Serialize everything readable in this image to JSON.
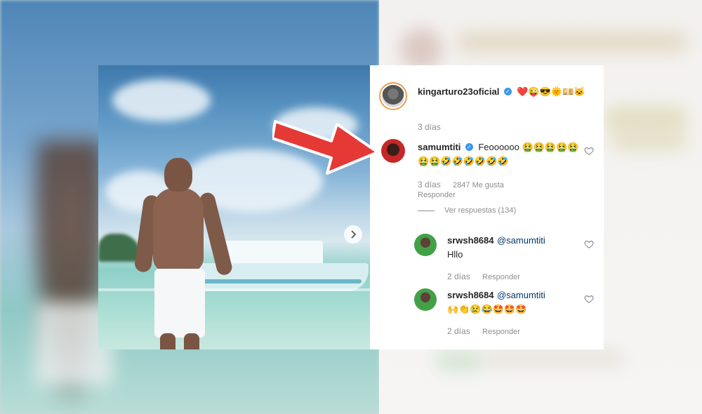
{
  "post": {
    "caption": {
      "username": "kingarturo23oficial",
      "text": "❤️😜😎🌞💴🐱",
      "age": "3 días"
    },
    "next_icon": "chevron-right-icon"
  },
  "comments": [
    {
      "username": "samumtiti",
      "text": "Feoooooo 🤮🤮🤮🤮🤮🤮🤮🤣🤣🤣🤣🤣🤣",
      "age": "3 días",
      "likes": "2847 Me gusta",
      "reply": "Responder",
      "view_replies": "Ver respuestas (134)"
    }
  ],
  "replies": [
    {
      "username": "srwsh8684",
      "mention": "@samumtiti",
      "text": "Hllo",
      "age": "2 días",
      "reply": "Responder"
    },
    {
      "username": "srwsh8684",
      "mention": "@samumtiti",
      "text": "🙌👏😢😂🤩🤩🤩",
      "age": "2 días",
      "reply": "Responder"
    }
  ],
  "colors": {
    "arrow": "#e53935",
    "verified": "#3897f0",
    "mention": "#00376b",
    "meta": "#8e8e8e"
  }
}
